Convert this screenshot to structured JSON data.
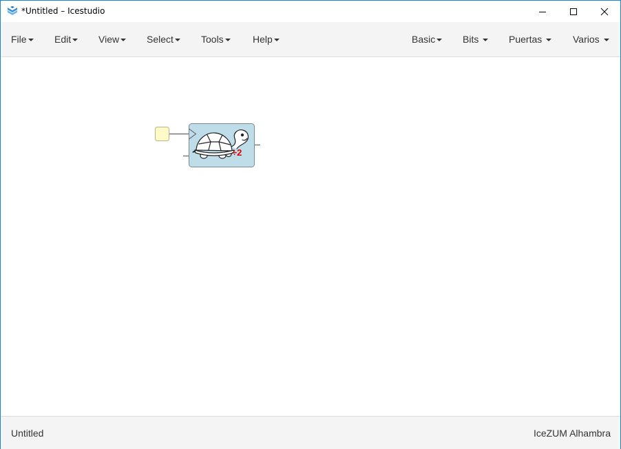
{
  "window": {
    "title": "*Untitled – Icestudio",
    "accent": "#1883d7"
  },
  "menus": {
    "left": [
      {
        "label": "File"
      },
      {
        "label": "Edit"
      },
      {
        "label": "View"
      },
      {
        "label": "Select"
      },
      {
        "label": "Tools"
      },
      {
        "label": "Help"
      }
    ],
    "right": [
      {
        "label": "Basic"
      },
      {
        "label": "Bits"
      },
      {
        "label": "Puertas"
      },
      {
        "label": "Varios"
      }
    ]
  },
  "canvas": {
    "block": {
      "icon": "turtle-icon",
      "badge": "÷2",
      "fill": "#bfdde9",
      "badge_color": "#e00000"
    },
    "input_port_fill": "#fffac8"
  },
  "status": {
    "project": "Untitled",
    "board": "IceZUM Alhambra"
  }
}
